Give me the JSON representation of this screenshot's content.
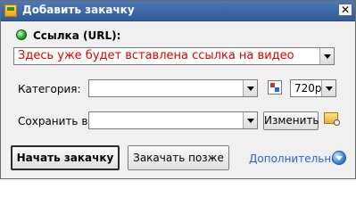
{
  "window": {
    "title": "Добавить закачку"
  },
  "url": {
    "label": "Ссылка (URL):",
    "value": "Здесь уже будет вставлена ссылка на видео"
  },
  "category": {
    "label": "Категория:",
    "value": ""
  },
  "quality": {
    "value": "720p"
  },
  "save": {
    "label": "Сохранить в:",
    "value": "",
    "change_button": "Изменить"
  },
  "actions": {
    "start": "Начать закачку",
    "later": "Закачать позже",
    "more": "Дополнительно"
  },
  "icons": {
    "app": "app-icon",
    "close": "close-icon",
    "url_status": "green-circle-icon",
    "category_picker": "category-icon",
    "folder": "folder-icon",
    "more": "chevron-down-icon"
  }
}
